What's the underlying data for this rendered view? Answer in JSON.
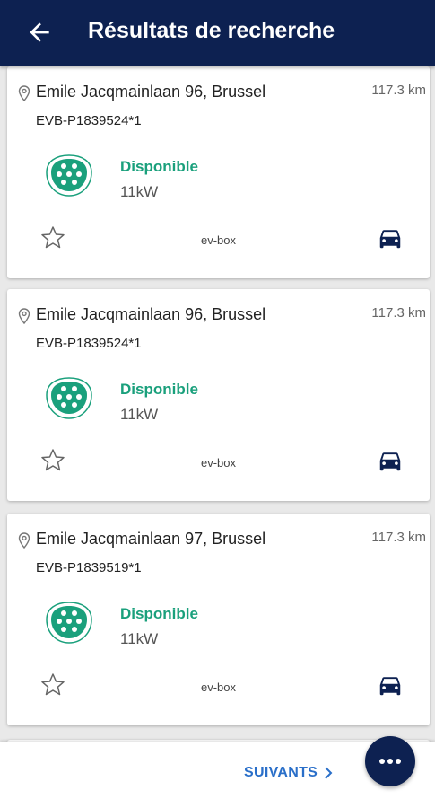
{
  "header": {
    "title": "Résultats de recherche",
    "back_icon": "arrow-left-icon"
  },
  "colors": {
    "header_bg": "#0d2151",
    "available": "#1aa07c",
    "accent": "#0d2151",
    "link": "#2a6fc9"
  },
  "results": [
    {
      "address": "Emile Jacqmainlaan 96, Brussel",
      "distance": "117.3 km",
      "evse_id": "EVB-P1839524*1",
      "status": "Disponible",
      "power": "11kW",
      "operator": "ev-box"
    },
    {
      "address": "Emile Jacqmainlaan 96, Brussel",
      "distance": "117.3 km",
      "evse_id": "EVB-P1839524*1",
      "status": "Disponible",
      "power": "11kW",
      "operator": "ev-box"
    },
    {
      "address": "Emile Jacqmainlaan 97, Brussel",
      "distance": "117.3 km",
      "evse_id": "EVB-P1839519*1",
      "status": "Disponible",
      "power": "11kW",
      "operator": "ev-box"
    }
  ],
  "footer": {
    "next_label": "SUIVANTS",
    "more_icon": "more-horizontal-icon"
  }
}
